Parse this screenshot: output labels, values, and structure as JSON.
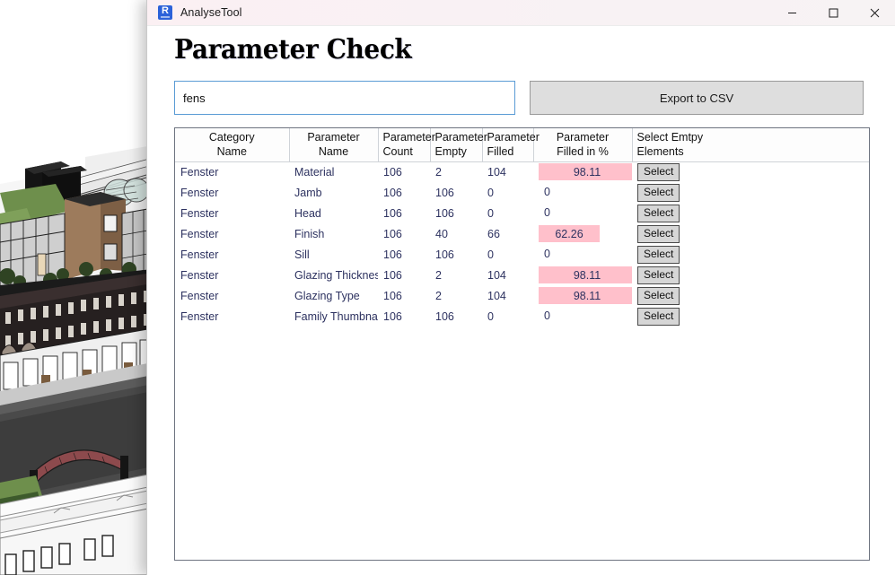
{
  "window": {
    "title": "AnalyseTool",
    "icon": "revit-r-icon",
    "controls": {
      "minimize": "minimize-icon",
      "maximize": "maximize-icon",
      "close": "close-icon"
    }
  },
  "page": {
    "title": "Parameter Check"
  },
  "toolbar": {
    "search_value": "fens",
    "search_placeholder": "",
    "export_label": "Export to CSV"
  },
  "table": {
    "headers": [
      "Category\nName",
      "Parameter\nName",
      "Parameter\nCount",
      "Parameter\nEmpty",
      "Parameter\nFilled",
      "Parameter\nFilled in %",
      "Select Emtpy\nElements"
    ],
    "header_lines": [
      [
        "Category",
        "Name"
      ],
      [
        "Parameter",
        "Name"
      ],
      [
        "Parameter",
        "Count"
      ],
      [
        "Parameter",
        "Empty"
      ],
      [
        "Parameter",
        "Filled"
      ],
      [
        "Parameter",
        "Filled in %"
      ],
      [
        "Select Emtpy",
        "Elements"
      ]
    ],
    "select_label": "Select",
    "highlight_color": "#ffc0cb",
    "text_color": "#2d3260",
    "rows": [
      {
        "category": "Fenster",
        "parameter": "Material",
        "count": "106",
        "empty": "2",
        "filled": "104",
        "pct": "98.11",
        "pct_value": 98.11,
        "select": "Select"
      },
      {
        "category": "Fenster",
        "parameter": "Jamb",
        "count": "106",
        "empty": "106",
        "filled": "0",
        "pct": "0",
        "pct_value": 0,
        "select": "Select"
      },
      {
        "category": "Fenster",
        "parameter": "Head",
        "count": "106",
        "empty": "106",
        "filled": "0",
        "pct": "0",
        "pct_value": 0,
        "select": "Select"
      },
      {
        "category": "Fenster",
        "parameter": "Finish",
        "count": "106",
        "empty": "40",
        "filled": "66",
        "pct": "62.26",
        "pct_value": 62.26,
        "select": "Select"
      },
      {
        "category": "Fenster",
        "parameter": "Sill",
        "count": "106",
        "empty": "106",
        "filled": "0",
        "pct": "0",
        "pct_value": 0,
        "select": "Select"
      },
      {
        "category": "Fenster",
        "parameter": "Glazing Thickness",
        "count": "106",
        "empty": "2",
        "filled": "104",
        "pct": "98.11",
        "pct_value": 98.11,
        "select": "Select"
      },
      {
        "category": "Fenster",
        "parameter": "Glazing Type",
        "count": "106",
        "empty": "2",
        "filled": "104",
        "pct": "98.11",
        "pct_value": 98.11,
        "select": "Select"
      },
      {
        "category": "Fenster",
        "parameter": "Family Thumbnail",
        "count": "106",
        "empty": "106",
        "filled": "0",
        "pct": "0",
        "pct_value": 0,
        "select": "Select"
      }
    ]
  },
  "background": {
    "description": "revit-3d-model-viewport"
  }
}
